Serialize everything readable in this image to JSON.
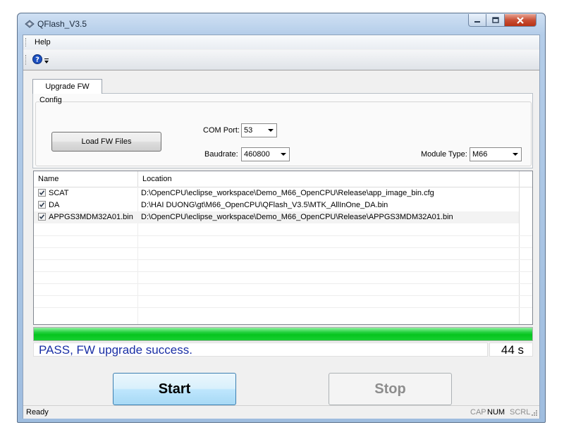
{
  "window": {
    "title": "QFlash_V3.5"
  },
  "menubar": {
    "items": [
      "Help"
    ]
  },
  "toolbar": {
    "help_icon": "help-question-icon",
    "dropdown_icon": "overflow-chevron-icon"
  },
  "tabs": [
    {
      "label": "Upgrade FW",
      "active": true
    }
  ],
  "config": {
    "group_label": "Config",
    "load_button": "Load FW Files",
    "com_port_label": "COM Port:",
    "com_port_value": "53",
    "baudrate_label": "Baudrate:",
    "baudrate_value": "460800",
    "module_type_label": "Module Type:",
    "module_type_value": "M66"
  },
  "file_list": {
    "columns": [
      "Name",
      "Location"
    ],
    "rows": [
      {
        "checked": true,
        "name": "SCAT",
        "location": "D:\\OpenCPU\\eclipse_workspace\\Demo_M66_OpenCPU\\Release\\app_image_bin.cfg"
      },
      {
        "checked": true,
        "name": "DA",
        "location": "D:\\HAI DUONG\\gt\\M66_OpenCPU\\QFlash_V3.5\\MTK_AllInOne_DA.bin"
      },
      {
        "checked": true,
        "name": "APPGS3MDM32A01.bin",
        "location": "D:\\OpenCPU\\eclipse_workspace\\Demo_M66_OpenCPU\\Release\\APPGS3MDM32A01.bin"
      }
    ]
  },
  "progress": {
    "percent": 100,
    "color": "#06c51e"
  },
  "status": {
    "message": "PASS, FW upgrade success.",
    "elapsed": "44 s",
    "message_color": "#1a2fa5"
  },
  "actions": {
    "start_label": "Start",
    "stop_label": "Stop"
  },
  "statusbar": {
    "text": "Ready",
    "indicators": [
      {
        "label": "CAP",
        "active": false
      },
      {
        "label": "NUM",
        "active": true
      },
      {
        "label": "SCRL",
        "active": false
      }
    ]
  }
}
